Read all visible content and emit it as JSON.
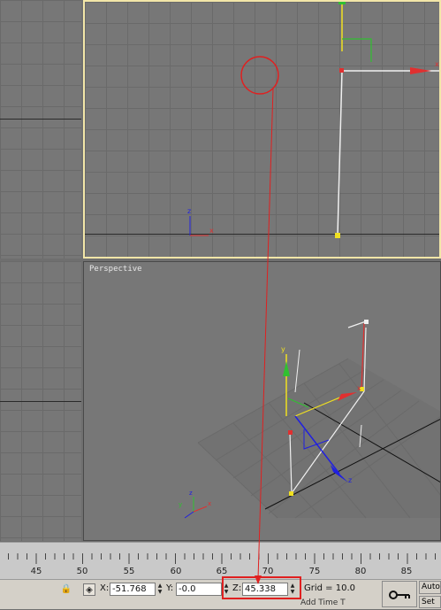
{
  "viewports": {
    "perspective_label": "Perspective"
  },
  "axes": {
    "x_label": "x",
    "y_label": "y",
    "z_label": "z",
    "x_color": "#e03030",
    "y_color": "#30c030",
    "z_color": "#2020e0"
  },
  "ruler": {
    "ticks": [
      "45",
      "50",
      "55",
      "60",
      "65",
      "70",
      "75",
      "80",
      "85"
    ]
  },
  "status": {
    "x_label": "X:",
    "x_value": "-51.768",
    "y_label": "Y:",
    "y_value": "-0.0",
    "z_label": "Z:",
    "z_value": "45.338",
    "grid_text": "Grid = 10.0",
    "auto_label": "Auto",
    "set_label": "Set",
    "add_time_text": "Add Time T"
  },
  "annotation_color": "#e02020",
  "selection_border_color": "#f2e6a8"
}
